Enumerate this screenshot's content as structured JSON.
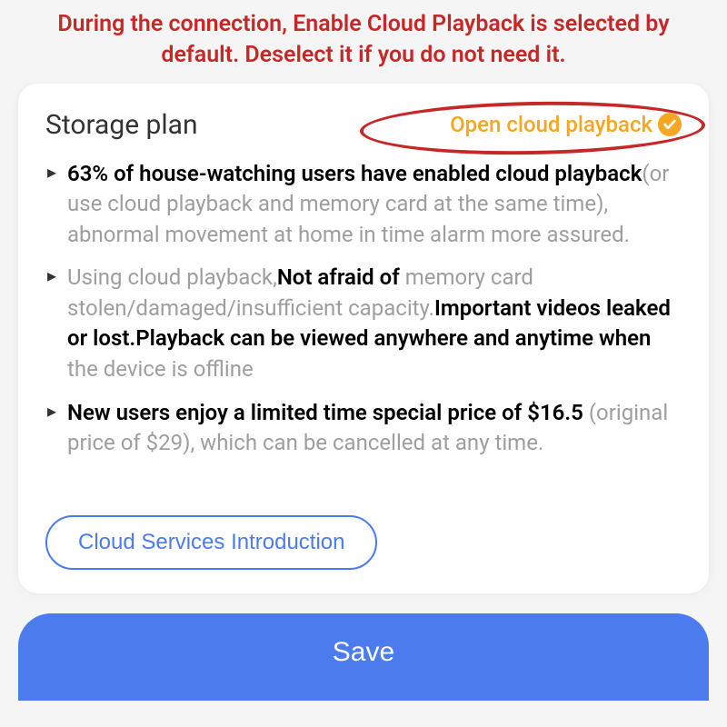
{
  "annotation": "During the connection, Enable Cloud Playback is selected by default. Deselect it if you do not need it.",
  "card": {
    "title": "Storage plan",
    "toggle_label": "Open cloud playback",
    "toggle_checked": true
  },
  "bullets": [
    {
      "bold1": "63% of house-watching users have enabled cloud playback",
      "grey1": "(or use cloud playback and memory card at the same time), abnormal movement at home in time alarm more assured."
    },
    {
      "grey_lead": "Using cloud playback,",
      "bold_mid1": "Not afraid of",
      "grey_mid": " memory card stolen/damaged/insufficient capacity.",
      "bold_mid2": "Important videos leaked or lost.Playback can be viewed anywhere and anytime when",
      "grey_tail": " the device is offline"
    },
    {
      "bold1": "New users enjoy a limited time special price of $16.5",
      "grey1": " (original price of $29), which can be cancelled at any time."
    }
  ],
  "buttons": {
    "intro": "Cloud Services Introduction",
    "save": "Save"
  }
}
